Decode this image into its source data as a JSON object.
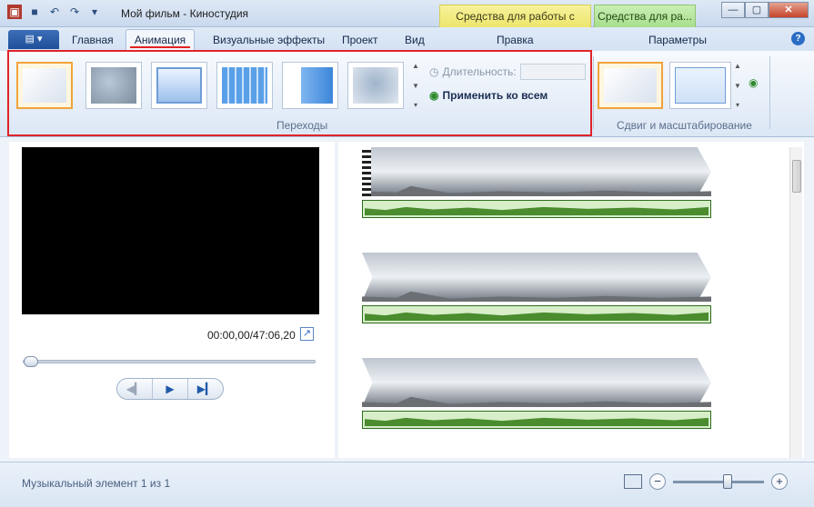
{
  "app": {
    "title": "Мой фильм - Киностудия"
  },
  "context_tabs": {
    "video": "Средства для работы с видео",
    "audio": "Средства для ра..."
  },
  "tabs": {
    "file": "▤ ▾",
    "home": "Главная",
    "animation": "Анимация",
    "visual_effects": "Визуальные эффекты",
    "project": "Проект",
    "view": "Вид",
    "edit": "Правка",
    "options": "Параметры"
  },
  "ribbon": {
    "transitions_group": "Переходы",
    "duration_label": "Длительность:",
    "apply_all": "Применить ко всем",
    "panzoom_group": "Сдвиг и масштабирование"
  },
  "preview": {
    "timecode": "00:00,00/47:06,20"
  },
  "status": {
    "text": "Музыкальный элемент 1 из 1"
  },
  "zoom": {
    "level": 0.6
  },
  "icons": {
    "help": "?",
    "play": "▶",
    "prev": "◀▎",
    "next": "▶▎"
  }
}
